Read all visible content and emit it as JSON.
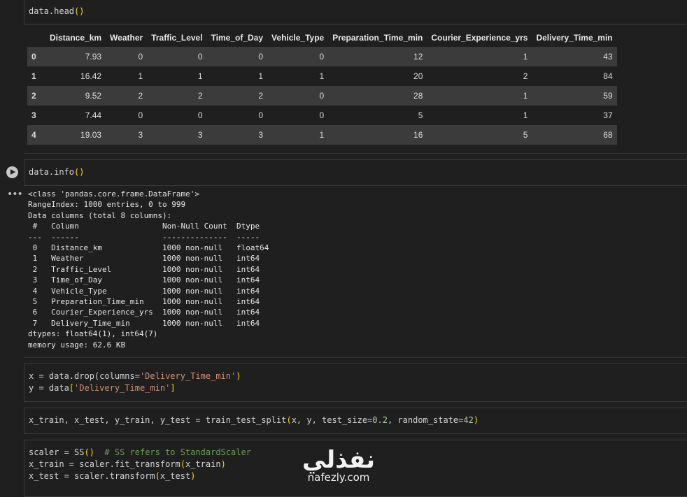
{
  "cells": {
    "head_code": "data.head()",
    "info_code": "data.info()",
    "drop_line1_pre": "x = data.drop(columns=",
    "drop_line1_str": "'Delivery_Time_min'",
    "drop_line1_post": ")",
    "drop_line2_pre": "y = data",
    "drop_line2_str": "'Delivery_Time_min'",
    "split_code": "x_train, x_test, y_train, y_test = train_test_split(x, y, test_size=0.2, random_state=42)",
    "scaler_line1_pre": "scaler = SS()  ",
    "scaler_line1_comment": "# SS refers to StandardScaler",
    "scaler_line2": "x_train = scaler.fit_transform(x_train)",
    "scaler_line3": "x_test = scaler.transform(x_test)"
  },
  "dataframe": {
    "columns": [
      "Distance_km",
      "Weather",
      "Traffic_Level",
      "Time_of_Day",
      "Vehicle_Type",
      "Preparation_Time_min",
      "Courier_Experience_yrs",
      "Delivery_Time_min"
    ],
    "rows": [
      {
        "index": "0",
        "values": [
          "7.93",
          "0",
          "0",
          "0",
          "0",
          "12",
          "1",
          "43"
        ]
      },
      {
        "index": "1",
        "values": [
          "16.42",
          "1",
          "1",
          "1",
          "1",
          "20",
          "2",
          "84"
        ]
      },
      {
        "index": "2",
        "values": [
          "9.52",
          "2",
          "2",
          "2",
          "0",
          "28",
          "1",
          "59"
        ]
      },
      {
        "index": "3",
        "values": [
          "7.44",
          "0",
          "0",
          "0",
          "0",
          "5",
          "1",
          "37"
        ]
      },
      {
        "index": "4",
        "values": [
          "19.03",
          "3",
          "3",
          "3",
          "1",
          "16",
          "5",
          "68"
        ]
      }
    ]
  },
  "info_output": "<class 'pandas.core.frame.DataFrame'>\nRangeIndex: 1000 entries, 0 to 999\nData columns (total 8 columns):\n #   Column                  Non-Null Count  Dtype  \n---  ------                  --------------  -----  \n 0   Distance_km             1000 non-null   float64\n 1   Weather                 1000 non-null   int64  \n 2   Traffic_Level           1000 non-null   int64  \n 3   Time_of_Day             1000 non-null   int64  \n 4   Vehicle_Type            1000 non-null   int64  \n 5   Preparation_Time_min    1000 non-null   int64  \n 6   Courier_Experience_yrs  1000 non-null   int64  \n 7   Delivery_Time_min       1000 non-null   int64  \ndtypes: float64(1), int64(7)\nmemory usage: 62.6 KB",
  "watermark": {
    "arabic": "نفذلي",
    "latin": "nafezly.com"
  },
  "icons": {
    "run": "play-icon",
    "output_menu": "more-horizontal-icon"
  },
  "colors": {
    "background": "#1f1f1f",
    "stripe": "#3b3b3b",
    "string": "#ce9178",
    "number": "#b5cea8",
    "comment": "#6a9955",
    "bracket": "#ffd700"
  }
}
